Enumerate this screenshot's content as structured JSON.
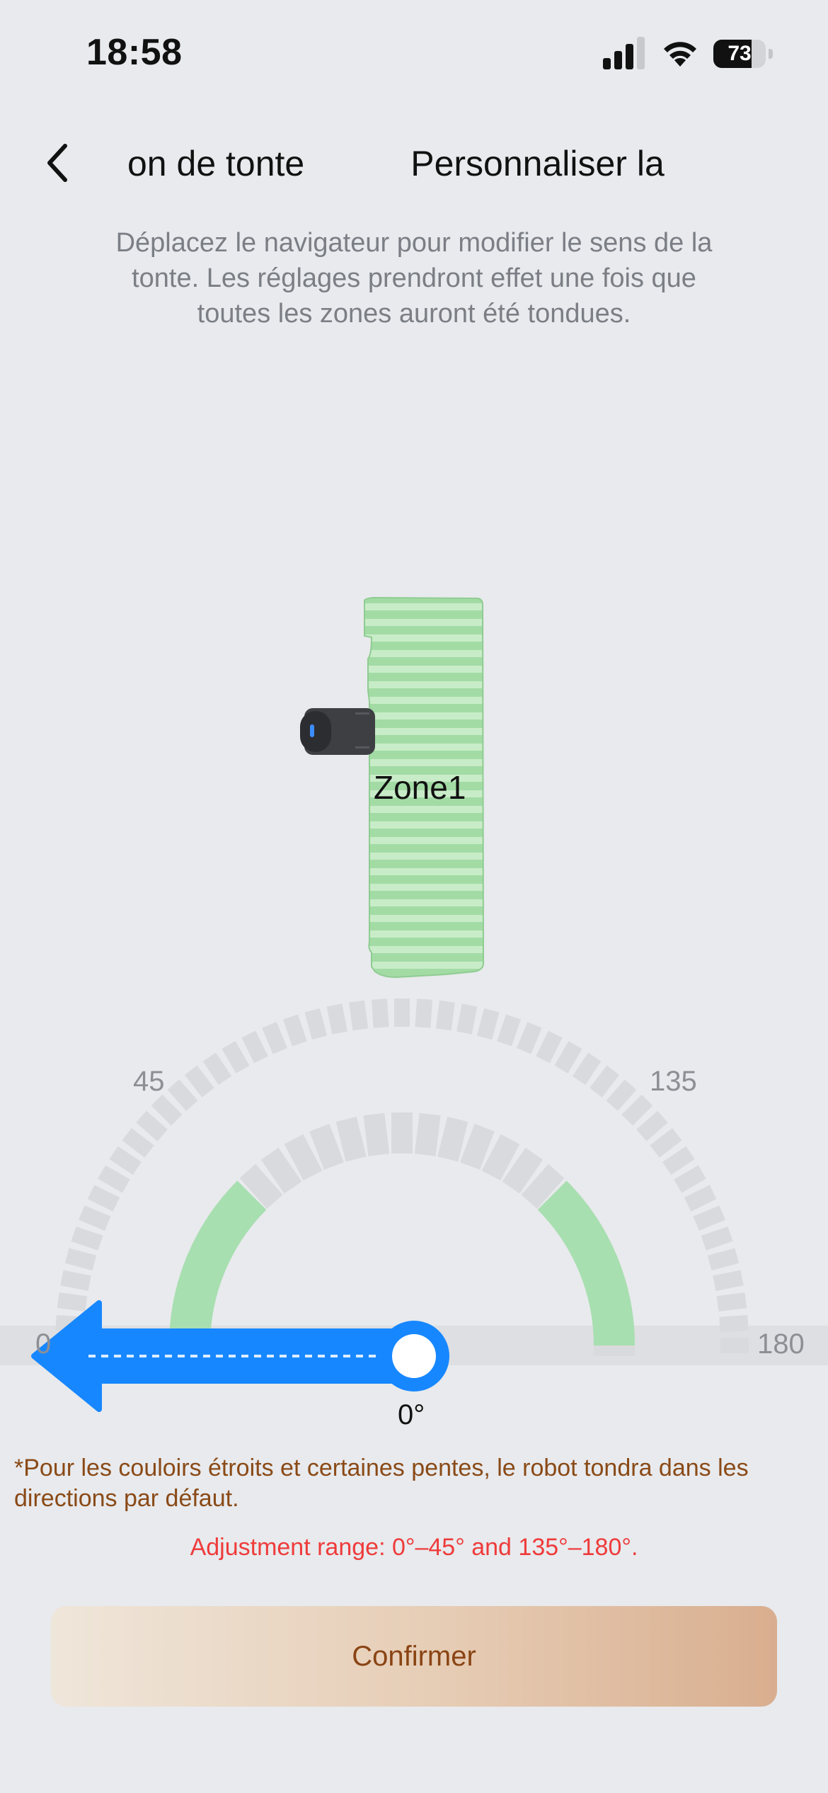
{
  "status_bar": {
    "time": "18:58",
    "battery": "73",
    "battery_level": 0.73
  },
  "nav": {
    "tabs": [
      {
        "label": "on de tonte",
        "active": true
      },
      {
        "label": "Personnaliser la"
      }
    ]
  },
  "instructions": "Déplacez le navigateur pour modifier le sens de la tonte. Les réglages prendront effet une fois que toutes les zones auront été tondues.",
  "map": {
    "zone_label": "Zone1",
    "zone_color": "#a8dea9",
    "stripe_color": "#c6ecc6"
  },
  "dial": {
    "labels": {
      "min": "0",
      "q1": "45",
      "q3": "135",
      "max": "180"
    },
    "value_label": "0°",
    "value_deg": 0,
    "allowed_ranges_deg": [
      [
        0,
        45
      ],
      [
        135,
        180
      ]
    ],
    "accent_color": "#1787ff",
    "allowed_color": "#a8dfb0"
  },
  "note": "*Pour les couloirs étroits et certaines pentes, le robot tondra dans les directions par défaut.",
  "range_warning": "Adjustment range: 0°–45° and 135°–180°.",
  "confirm_button": "Confirmer"
}
